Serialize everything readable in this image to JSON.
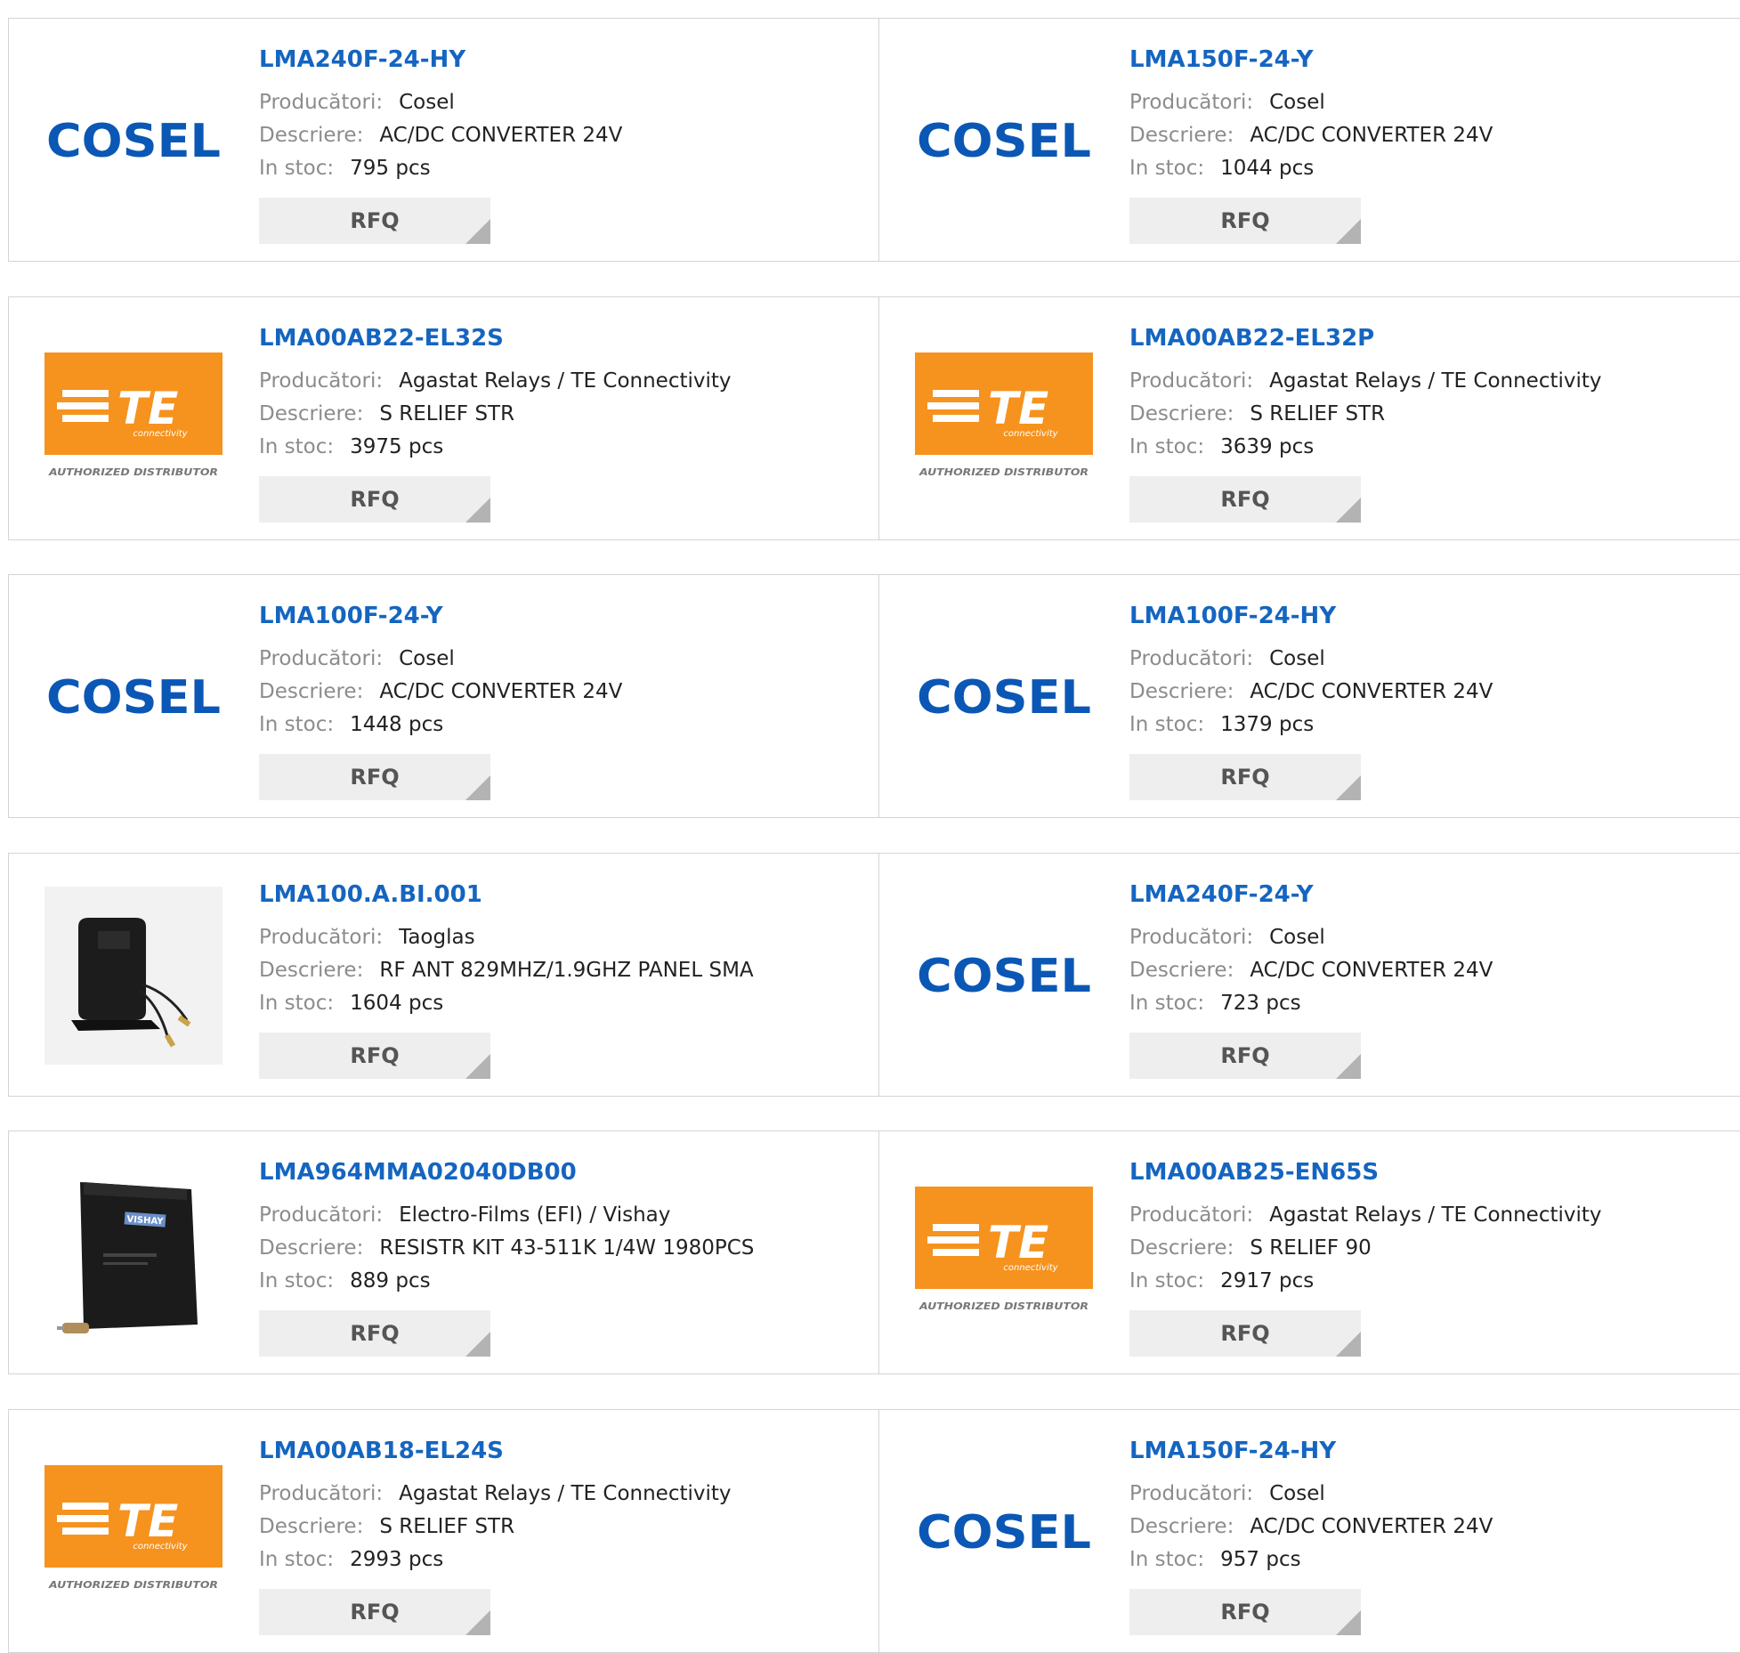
{
  "labels": {
    "manufacturer": "Producători:",
    "description": "Descriere:",
    "stock": "In stoc:",
    "rfq": "RFQ"
  },
  "brand_colors": {
    "link": "#1565c0",
    "cosel_blue": "#0b57b5",
    "te_orange": "#f6921e"
  },
  "logos": {
    "cosel": {
      "text": "COSEL"
    },
    "te": {
      "text": "TE",
      "sub": "connectivity",
      "tag": "AUTHORIZED DISTRIBUTOR"
    },
    "vishay": {
      "text": "VISHAY"
    }
  },
  "products": [
    {
      "pn": "LMA240F-24-HY",
      "manufacturer": "Cosel",
      "description": "AC/DC CONVERTER 24V",
      "stock": "795 pcs",
      "image": "cosel-logo"
    },
    {
      "pn": "LMA150F-24-Y",
      "manufacturer": "Cosel",
      "description": "AC/DC CONVERTER 24V",
      "stock": "1044 pcs",
      "image": "cosel-logo"
    },
    {
      "pn": "LMA00AB22-EL32S",
      "manufacturer": "Agastat Relays / TE Connectivity",
      "description": "S RELIEF STR",
      "stock": "3975 pcs",
      "image": "te-logo"
    },
    {
      "pn": "LMA00AB22-EL32P",
      "manufacturer": "Agastat Relays / TE Connectivity",
      "description": "S RELIEF STR",
      "stock": "3639 pcs",
      "image": "te-logo"
    },
    {
      "pn": "LMA100F-24-Y",
      "manufacturer": "Cosel",
      "description": "AC/DC CONVERTER 24V",
      "stock": "1448 pcs",
      "image": "cosel-logo"
    },
    {
      "pn": "LMA100F-24-HY",
      "manufacturer": "Cosel",
      "description": "AC/DC CONVERTER 24V",
      "stock": "1379 pcs",
      "image": "cosel-logo"
    },
    {
      "pn": "LMA100.A.BI.001",
      "manufacturer": "Taoglas",
      "description": "RF ANT 829MHZ/1.9GHZ PANEL SMA",
      "stock": "1604 pcs",
      "image": "antenna-photo"
    },
    {
      "pn": "LMA240F-24-Y",
      "manufacturer": "Cosel",
      "description": "AC/DC CONVERTER 24V",
      "stock": "723 pcs",
      "image": "cosel-logo"
    },
    {
      "pn": "LMA964MMA02040DB00",
      "manufacturer": "Electro-Films (EFI) / Vishay",
      "description": "RESISTR KIT 43-511K 1/4W 1980PCS",
      "stock": "889 pcs",
      "image": "kit-photo"
    },
    {
      "pn": "LMA00AB25-EN65S",
      "manufacturer": "Agastat Relays / TE Connectivity",
      "description": "S RELIEF 90",
      "stock": "2917 pcs",
      "image": "te-logo"
    },
    {
      "pn": "LMA00AB18-EL24S",
      "manufacturer": "Agastat Relays / TE Connectivity",
      "description": "S RELIEF STR",
      "stock": "2993 pcs",
      "image": "te-logo"
    },
    {
      "pn": "LMA150F-24-HY",
      "manufacturer": "Cosel",
      "description": "AC/DC CONVERTER 24V",
      "stock": "957 pcs",
      "image": "cosel-logo"
    }
  ]
}
